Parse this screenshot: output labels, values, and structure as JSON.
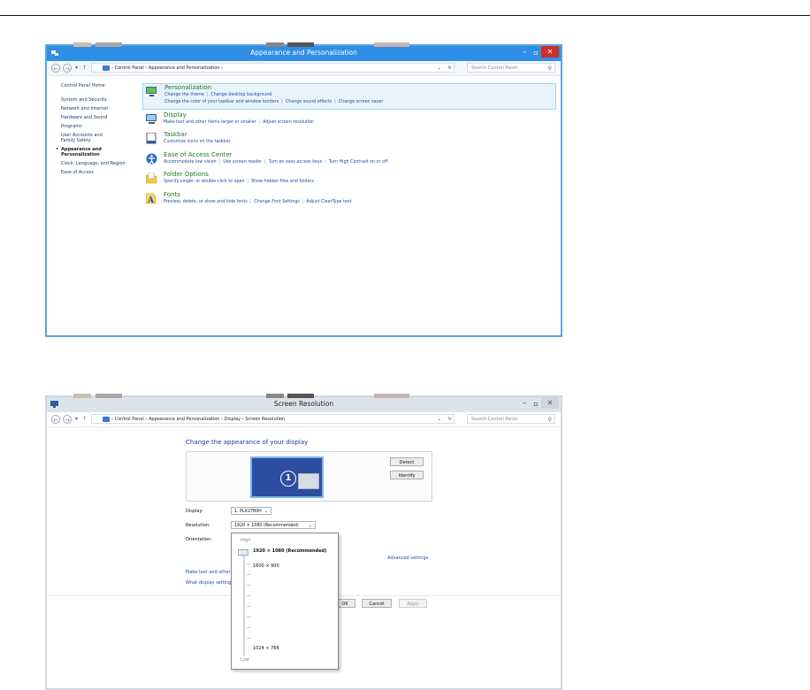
{
  "window1": {
    "title": "Appearance and Personalization",
    "breadcrumb": [
      "Control Panel",
      "Appearance and Personalization"
    ],
    "search_placeholder": "Search Control Panel",
    "sidebar": [
      {
        "label": "Control Panel Home",
        "active": false
      },
      {
        "label": "System and Security",
        "active": false
      },
      {
        "label": "Network and Internet",
        "active": false
      },
      {
        "label": "Hardware and Sound",
        "active": false
      },
      {
        "label": "Programs",
        "active": false
      },
      {
        "label": "User Accounts and Family Safety",
        "active": false
      },
      {
        "label": "Appearance and Personalization",
        "active": true
      },
      {
        "label": "Clock, Language, and Region",
        "active": false
      },
      {
        "label": "Ease of Access",
        "active": false
      }
    ],
    "categories": [
      {
        "name": "personalization",
        "icon": "personalization-icon",
        "heading": "Personalization",
        "lines": [
          [
            "Change the theme",
            "Change desktop background"
          ],
          [
            "Change the color of your taskbar and window borders",
            "Change sound effects",
            "Change screen saver"
          ]
        ]
      },
      {
        "name": "display",
        "icon": "display-icon",
        "heading": "Display",
        "lines": [
          [
            "Make text and other items larger or smaller",
            "Adjust screen resolution"
          ]
        ]
      },
      {
        "name": "taskbar",
        "icon": "taskbar-icon",
        "heading": "Taskbar",
        "lines": [
          [
            "Customize icons on the taskbar"
          ]
        ]
      },
      {
        "name": "ease-of-access",
        "icon": "ease-of-access-icon",
        "heading": "Ease of Access Center",
        "lines": [
          [
            "Accommodate low vision",
            "Use screen reader",
            "Turn on easy access keys",
            "Turn High Contrast on or off"
          ]
        ]
      },
      {
        "name": "folder-options",
        "icon": "folder-icon",
        "heading": "Folder Options",
        "lines": [
          [
            "Specify single- or double-click to open",
            "Show hidden files and folders"
          ]
        ]
      },
      {
        "name": "fonts",
        "icon": "fonts-icon",
        "heading": "Fonts",
        "lines": [
          [
            "Preview, delete, or show and hide fonts",
            "Change Font Settings",
            "Adjust ClearType text"
          ]
        ]
      }
    ]
  },
  "window2": {
    "title": "Screen Resolution",
    "breadcrumb": [
      "Control Panel",
      "Appearance and Personalization",
      "Display",
      "Screen Resolution"
    ],
    "search_placeholder": "Search Control Panel",
    "heading": "Change the appearance of your display",
    "monitor_number": "1",
    "detect_label": "Detect",
    "identify_label": "Identify",
    "display_label": "Display:",
    "display_value": "1. PLX2780H",
    "resolution_label": "Resolution:",
    "resolution_value": "1920 × 1080 (Recommended)",
    "orientation_label": "Orientation:",
    "advanced_link": "Advanced settings",
    "link_text_size": "Make text and other",
    "link_what_display": "What display setting",
    "ok_label": "OK",
    "cancel_label": "Cancel",
    "apply_label": "Apply",
    "popup": {
      "high_label": "High",
      "low_label": "Low",
      "options": [
        "1920 × 1080 (Recommended)",
        "1600 × 900",
        "1024 × 768"
      ],
      "selected": "1920 × 1080 (Recommended)"
    }
  },
  "colors": {
    "titlebar_active": "#2f8ee5",
    "close_red": "#c9302c",
    "link_blue": "#1d4da3",
    "heading_green": "#1a7a1a"
  }
}
